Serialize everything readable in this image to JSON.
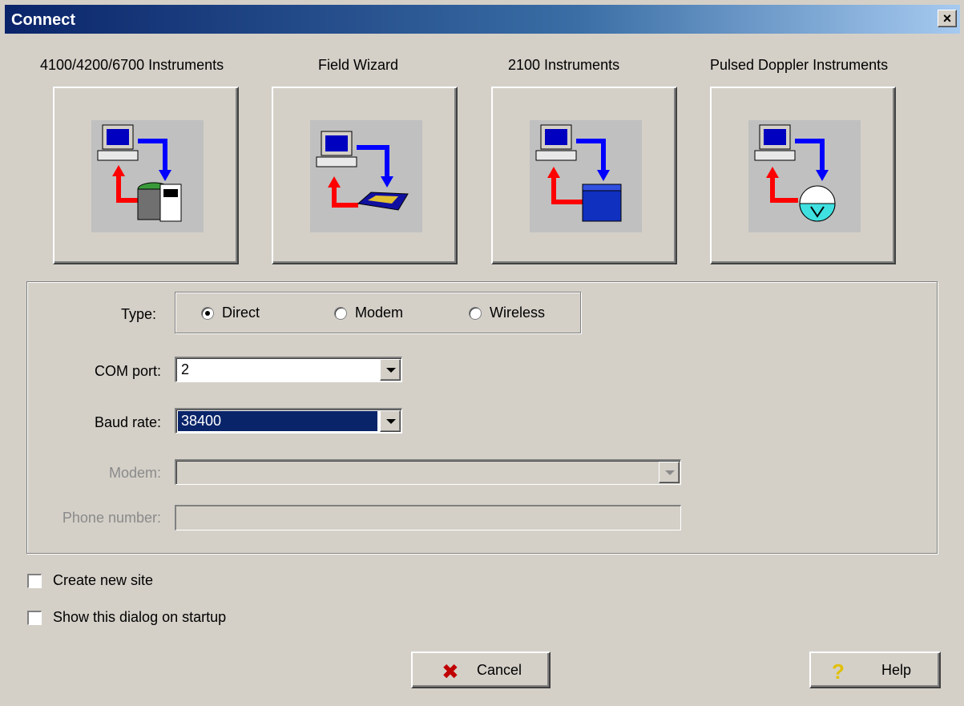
{
  "window": {
    "title": "Connect",
    "close_glyph": "×"
  },
  "instruments": [
    {
      "label": "4100/4200/6700 Instruments",
      "icon": "sampler-connect-icon"
    },
    {
      "label": "Field Wizard",
      "icon": "field-wizard-connect-icon"
    },
    {
      "label": "2100 Instruments",
      "icon": "flow-module-connect-icon"
    },
    {
      "label": "Pulsed Doppler Instruments",
      "icon": "doppler-connect-icon"
    }
  ],
  "connection": {
    "type_label": "Type:",
    "type_options": [
      "Direct",
      "Modem",
      "Wireless"
    ],
    "type_selected": "Direct",
    "com_port_label": "COM port:",
    "com_port_value": "2",
    "baud_rate_label": "Baud rate:",
    "baud_rate_value": "38400",
    "modem_label": "Modem:",
    "modem_value": "",
    "phone_label": "Phone number:",
    "phone_value": ""
  },
  "options": {
    "create_new_site": {
      "label": "Create new site",
      "checked": false
    },
    "show_on_startup": {
      "label": "Show this dialog on startup",
      "checked": false
    }
  },
  "buttons": {
    "cancel": {
      "label": "Cancel",
      "icon": "x-icon",
      "icon_color": "#c00000"
    },
    "help": {
      "label": "Help",
      "icon": "question-icon",
      "icon_color": "#e0c000"
    }
  },
  "colors": {
    "titlebar": "#0a246a",
    "face": "#d4d0c8",
    "selection": "#0a246a"
  }
}
